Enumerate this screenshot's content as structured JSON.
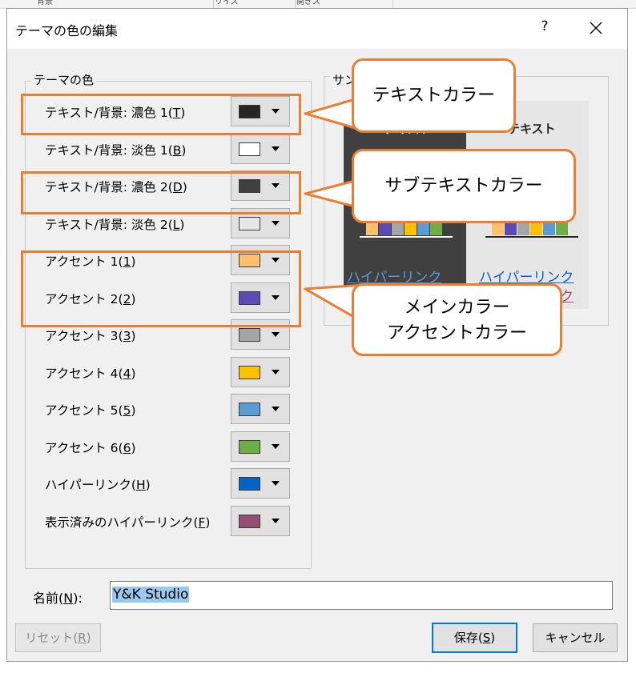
{
  "background": {
    "tabs": [
      "背景",
      "リイズ",
      "開ぎス"
    ]
  },
  "dialog": {
    "title": "テーマの色の編集",
    "help_label": "?",
    "theme_colors_group": "テーマの色",
    "sample_group": "サン",
    "rows": [
      {
        "label": "テキスト/背景: 濃色 1(",
        "key": "T",
        "swatch": "#262626"
      },
      {
        "label": "テキスト/背景: 淡色 1(",
        "key": "B",
        "swatch": "#ffffff"
      },
      {
        "label": "テキスト/背景: 濃色 2(",
        "key": "D",
        "swatch": "#404040"
      },
      {
        "label": "テキスト/背景: 淡色 2(",
        "key": "L",
        "swatch": "#e7e6e6"
      },
      {
        "label": "アクセント 1(",
        "key": "1",
        "swatch": "#ffc06e"
      },
      {
        "label": "アクセント 2(",
        "key": "2",
        "swatch": "#5b4bb4"
      },
      {
        "label": "アクセント 3(",
        "key": "3",
        "swatch": "#a5a5a5"
      },
      {
        "label": "アクセント 4(",
        "key": "4",
        "swatch": "#ffc000"
      },
      {
        "label": "アクセント 5(",
        "key": "5",
        "swatch": "#5b9bd5"
      },
      {
        "label": "アクセント 6(",
        "key": "6",
        "swatch": "#70ad47"
      },
      {
        "label": "ハイパーリンク(",
        "key": "H",
        "swatch": "#0563c1"
      },
      {
        "label": "表示済みのハイパーリンク(",
        "key": "F",
        "swatch": "#954f72"
      }
    ],
    "sample": {
      "text_label": "テキスト",
      "hyperlink": "ハイパーリンク",
      "visited_hyperlink": "ハイパーリンク",
      "visited_tail": "ンク",
      "bars": [
        {
          "color": "#ffc06e",
          "value": 0.55
        },
        {
          "color": "#5b4bb4",
          "value": 0.75
        },
        {
          "color": "#a5a5a5",
          "value": 0.75
        },
        {
          "color": "#ffc000",
          "value": 0.75
        },
        {
          "color": "#5b9bd5",
          "value": 0.75
        },
        {
          "color": "#70ad47",
          "value": 0.5
        }
      ]
    },
    "callouts": {
      "text_color": "テキストカラー",
      "subtext_color": "サブテキストカラー",
      "accent_line1": "メインカラー",
      "accent_line2": "アクセントカラー"
    },
    "name": {
      "label": "名前(",
      "key": "N",
      "suffix": "):",
      "value": "Y&K Studio"
    },
    "buttons": {
      "reset": "リセット(",
      "reset_key": "R",
      "save": "保存(",
      "save_key": "S",
      "cancel": "キャンセル"
    },
    "accent_color": "#ed7d31"
  }
}
